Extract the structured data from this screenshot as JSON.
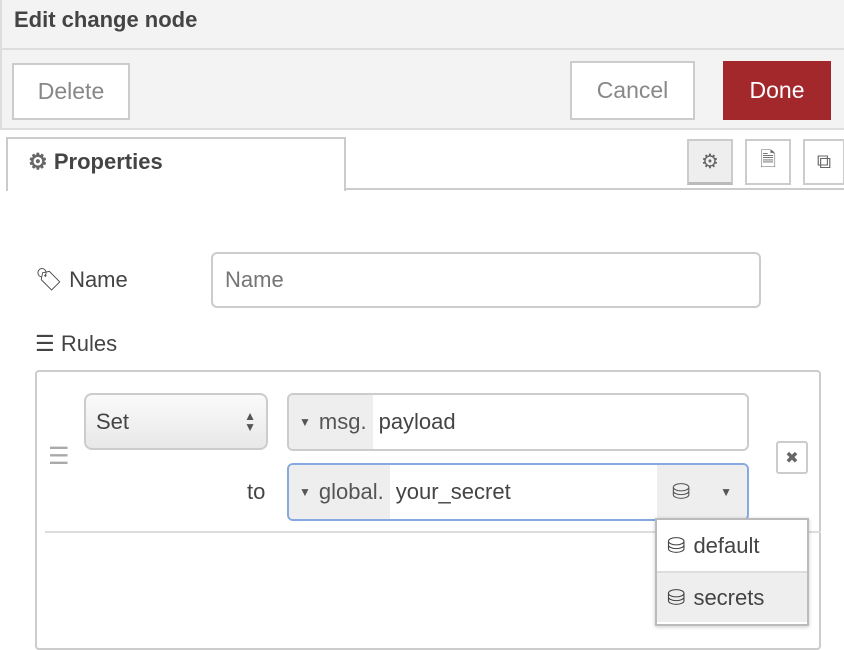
{
  "header": {
    "title": "Edit change node"
  },
  "toolbar": {
    "delete": "Delete",
    "cancel": "Cancel",
    "done": "Done",
    "done_color": "#a3282c"
  },
  "tabs": {
    "properties": "Properties"
  },
  "form": {
    "name_label": "Name",
    "name_placeholder": "Name",
    "name_value": "",
    "rules_label": "Rules"
  },
  "rule": {
    "action": "Set",
    "target_type": "msg.",
    "target_value": "payload",
    "to_label": "to",
    "source_type": "global.",
    "source_value": "your_secret"
  },
  "context_menu": {
    "items": [
      {
        "label": "default"
      },
      {
        "label": "secrets"
      }
    ]
  }
}
